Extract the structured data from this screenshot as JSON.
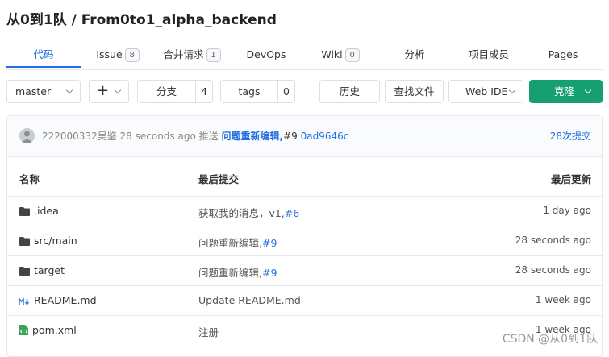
{
  "repo": {
    "title": "从0到1队 / From0to1_alpha_backend"
  },
  "tabs": [
    {
      "label": "代码"
    },
    {
      "label": "Issue",
      "badge": "8"
    },
    {
      "label": "合并请求",
      "badge": "1"
    },
    {
      "label": "DevOps"
    },
    {
      "label": "Wiki",
      "badge": "0"
    },
    {
      "label": "分析"
    },
    {
      "label": "项目成员"
    },
    {
      "label": "Pages"
    }
  ],
  "toolbar": {
    "branch": "master",
    "add": "+",
    "branches_label": "分支",
    "branches_count": "4",
    "tags_label": "tags",
    "tags_count": "0",
    "history": "历史",
    "find_file": "查找文件",
    "web_ide": "Web IDE",
    "clone": "克隆"
  },
  "commit": {
    "author": "222000332吴鉴",
    "time": "28 seconds ago",
    "verb": "推送",
    "message": "问题重新编辑,",
    "ref": "#9",
    "sha": "0ad9646c",
    "count": "28次提交"
  },
  "table": {
    "headers": [
      "名称",
      "最后提交",
      "最后更新"
    ],
    "rows": [
      {
        "icon": "folder-icon",
        "name": ".idea",
        "commit": "获取我的消息，v1,",
        "ref": "#6",
        "updated": "1 day ago"
      },
      {
        "icon": "folder-icon",
        "name": "src/main",
        "commit": "问题重新编辑,",
        "ref": "#9",
        "updated": "28 seconds ago"
      },
      {
        "icon": "folder-icon",
        "name": "target",
        "commit": "问题重新编辑,",
        "ref": "#9",
        "updated": "28 seconds ago"
      },
      {
        "icon": "markdown-icon",
        "name": "README.md",
        "commit": "Update README.md",
        "ref": "",
        "updated": "1 week ago"
      },
      {
        "icon": "xml-file-icon",
        "name": "pom.xml",
        "commit": "注册",
        "ref": "",
        "updated": "1 week ago"
      }
    ]
  },
  "watermark": "CSDN @从0到1队",
  "colors": {
    "accent": "#1f6fe0",
    "clone": "#169f73"
  }
}
